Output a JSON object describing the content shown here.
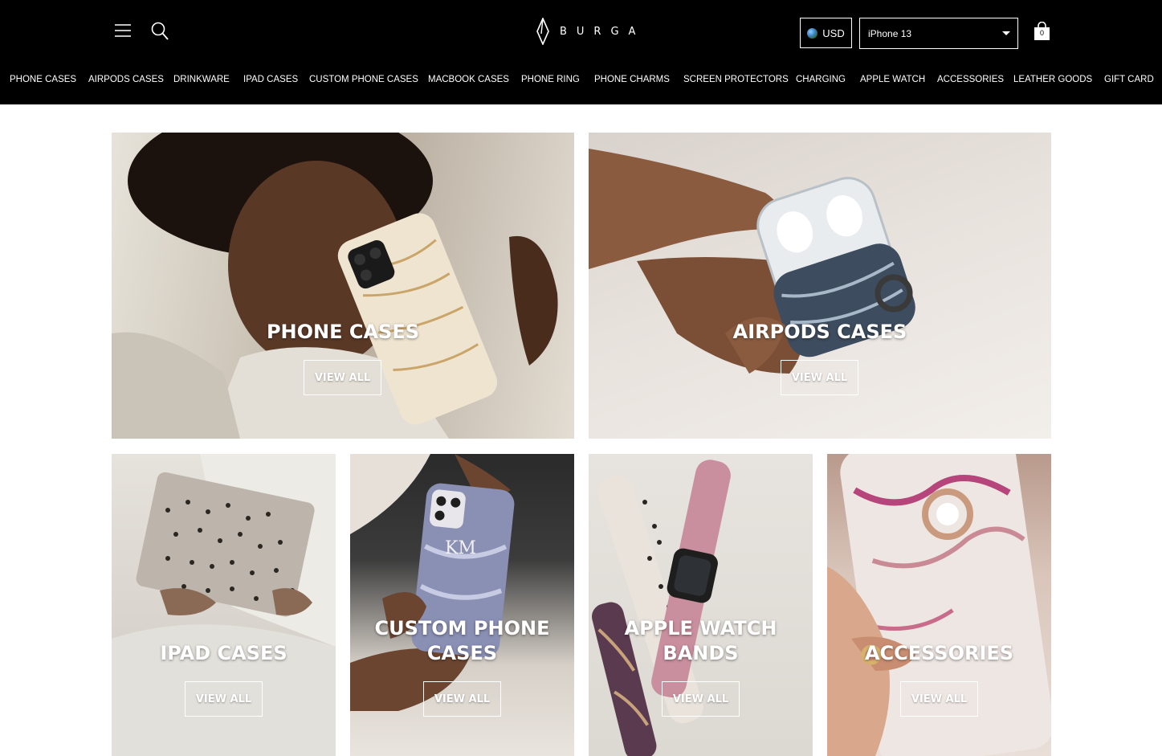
{
  "header": {
    "logo_text": "BURGA",
    "currency_label": "USD",
    "model_select_value": "iPhone 13",
    "cart_count": "0"
  },
  "nav": {
    "items": [
      "PHONE CASES",
      "AIRPODS CASES",
      "DRINKWARE",
      "IPAD CASES",
      "CUSTOM PHONE CASES",
      "MACBOOK CASES",
      "PHONE RING",
      "PHONE CHARMS",
      "SCREEN PROTECTORS",
      "CHARGING",
      "APPLE WATCH",
      "ACCESSORIES",
      "LEATHER GOODS",
      "GIFT CARD"
    ]
  },
  "tiles": [
    {
      "title_line1": "PHONE CASES",
      "title_line2": "",
      "button": "VIEW ALL"
    },
    {
      "title_line1": "AIRPODS CASES",
      "title_line2": "",
      "button": "VIEW ALL"
    },
    {
      "title_line1": "IPAD CASES",
      "title_line2": "",
      "button": "VIEW ALL"
    },
    {
      "title_line1": "CUSTOM PHONE",
      "title_line2": "CASES",
      "button": "VIEW ALL",
      "case_monogram": "KM"
    },
    {
      "title_line1": "APPLE WATCH",
      "title_line2": "BANDS",
      "button": "VIEW ALL"
    },
    {
      "title_line1": "ACCESSORIES",
      "title_line2": "",
      "button": "VIEW ALL"
    }
  ],
  "colors": {
    "header_bg": "#000000",
    "text_on_dark": "#ffffff"
  }
}
